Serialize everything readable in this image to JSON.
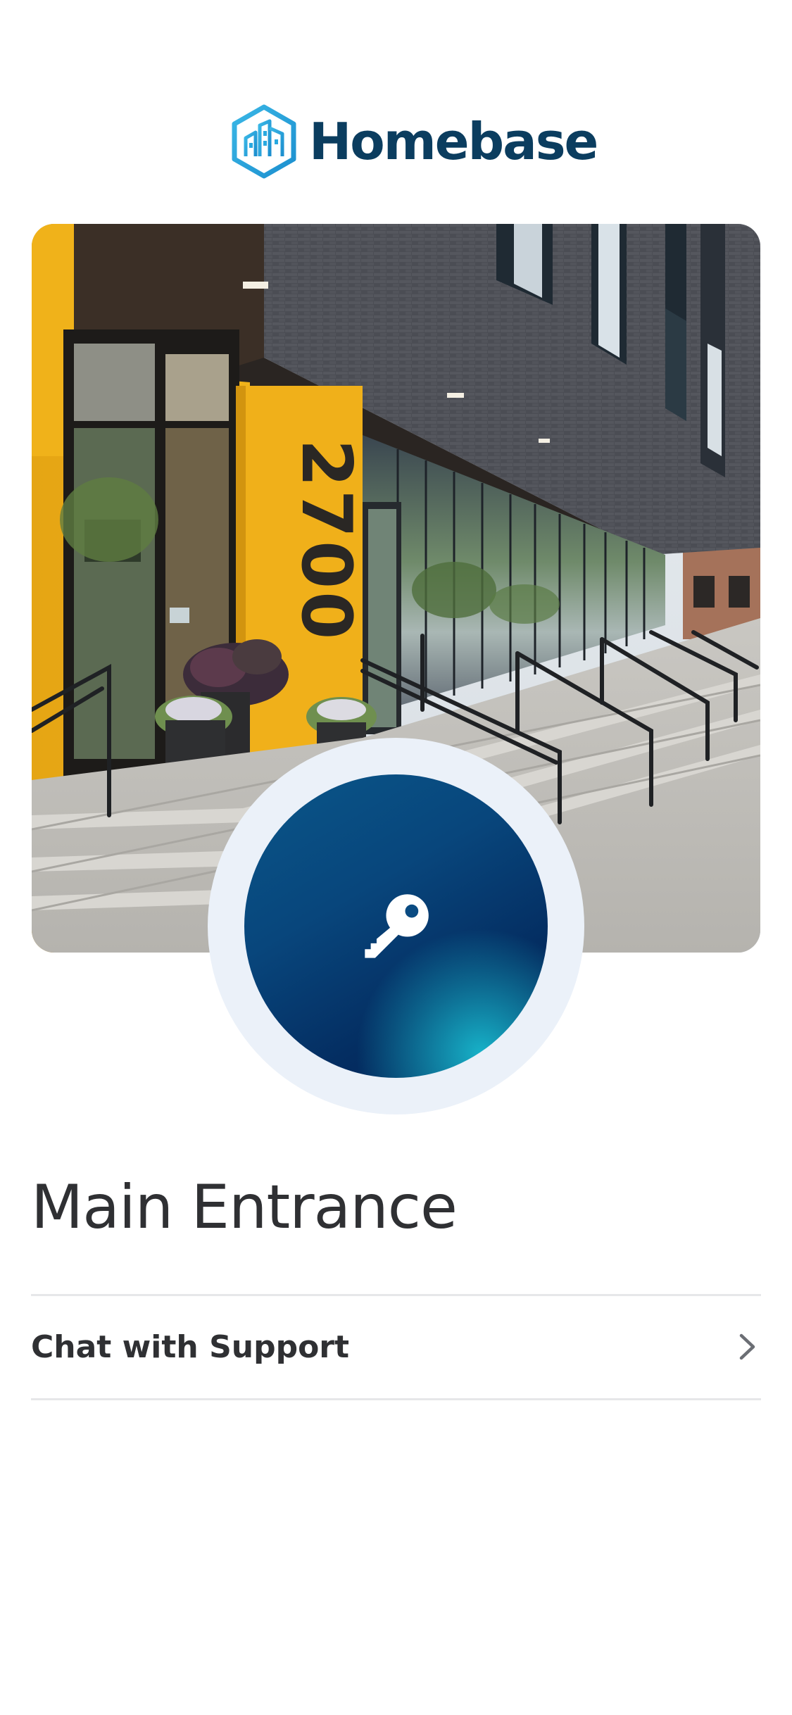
{
  "app": {
    "brand_name": "Homebase",
    "logo_icon": "homebase-building-hexagon-icon",
    "brand_colors": {
      "logo_mark": "#29a9e0",
      "logo_text": "#0b3d5f",
      "key_button_dark": "#02255a",
      "key_button_light": "#18b9ce",
      "key_ring": "#ebf1f9"
    }
  },
  "hero": {
    "image_description": "building-entrance-photo",
    "building_number": "2700"
  },
  "access": {
    "unlock_icon": "key-icon"
  },
  "door": {
    "name": "Main Entrance"
  },
  "menu": {
    "items": [
      {
        "label": "Chat with Support",
        "icon": "chevron-right-icon"
      }
    ]
  }
}
